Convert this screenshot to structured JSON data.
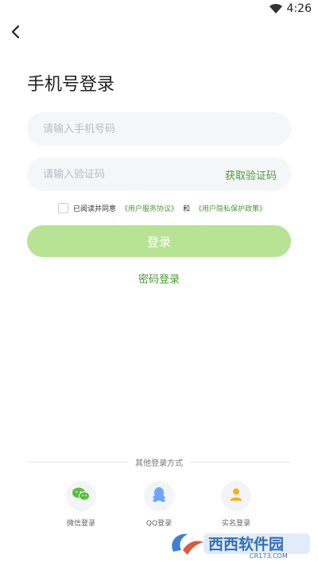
{
  "status_bar": {
    "time": "4:26"
  },
  "header": {
    "title": "手机号登录"
  },
  "form": {
    "phone_placeholder": "请输入手机号码",
    "code_placeholder": "请输入验证码",
    "get_code_label": "获取验证码",
    "agreement_prefix": "已阅读并同意",
    "terms_link": "《用户服务协议》",
    "agreement_and": "和",
    "privacy_link": "《用户隐私保护政策》",
    "login_button": "登录",
    "password_login": "密码登录"
  },
  "other_login": {
    "title": "其他登录方式",
    "options": [
      {
        "label": "微信登录",
        "icon": "wechat-icon",
        "color": "#5bbf3a"
      },
      {
        "label": "QQ登录",
        "icon": "qq-icon",
        "color": "#6fa3ff"
      },
      {
        "label": "实名登录",
        "icon": "person-icon",
        "color": "#f3b21a"
      }
    ]
  },
  "watermark": {
    "brand": "西西软件园",
    "domain": "CR173.COM"
  },
  "colors": {
    "accent_green": "#4a9a2f",
    "button_green_disabled": "#b8e394"
  }
}
